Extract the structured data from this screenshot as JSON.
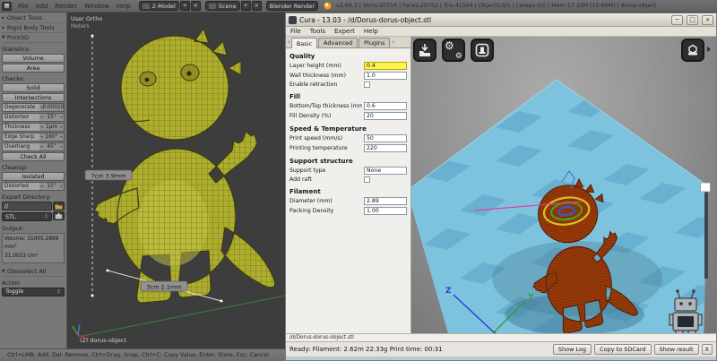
{
  "colors": {
    "bed_blue": "#7dc3de",
    "bed_checker": "#69b1d1",
    "model_red": "#a81e00",
    "wire_olive": "#aeae2e",
    "highlight_yellow": "#fbf24f",
    "axis_z_blue": "#2b43cc",
    "axis_y_green": "#2fa03a"
  },
  "icons": {
    "tri_right": "►",
    "tri_down": "▼",
    "arrow_left": "◂",
    "arrow_right": "▸",
    "updown": "↕",
    "plus": "+",
    "close": "×",
    "chev_left": "‹",
    "chev_right": "›",
    "gear": "⚙",
    "win_min": "─",
    "win_max": "□",
    "win_close": "×"
  },
  "blender": {
    "header": {
      "menus": [
        "File",
        "Add",
        "Render",
        "Window",
        "Help"
      ],
      "layout_name": "2-Model",
      "scene_name": "Scene",
      "engine": "Blender Render",
      "stats": "v2.66.3 | Verts:20754 | Faces:20752 | Tris:41504 | Objects:0/1 | Lamps:0/0 | Mem:17.33M (10.60M) | dorus-object"
    },
    "shelf": {
      "panel_object_tools": "Object Tools",
      "panel_rigid_body": "Rigid Body Tools",
      "panel_print3d": "Print3D",
      "statistics_label": "Statistics:",
      "volume_btn": "Volume",
      "area_btn": "Area",
      "checks_label": "Checks:",
      "solid_btn": "Solid",
      "intersections_btn": "Intersections",
      "checks": [
        {
          "label": "Degenerate",
          "value": "0.00010"
        },
        {
          "label": "Distorted",
          "value": "15°"
        },
        {
          "label": "Thickness",
          "value": "1μm"
        },
        {
          "label": "Edge Sharp",
          "value": "160°"
        },
        {
          "label": "Overhang",
          "value": "45°"
        }
      ],
      "check_all_btn": "Check All",
      "cleanup_label": "Cleanup:",
      "isolated_btn": "Isolated",
      "cleanup_distorted": {
        "label": "Distorted",
        "value": "15°"
      },
      "export_dir_label": "Export Directory:",
      "export_path": "//",
      "export_format": "STL",
      "output_label": "Output:",
      "output_line1": "Volume: 31005.2868 mm³",
      "output_line2": "31.0053 cm³",
      "deselect_panel": "(De)select All",
      "action_label": "Action",
      "action_value": "Toggle"
    },
    "viewport": {
      "view_label": "User Ortho",
      "units_label": "Meters",
      "measure_height": "7cm 3.9mm",
      "measure_width": "3cm 2.1mm",
      "object_label": "(2) dorus-object"
    },
    "status_bar": "Ctrl+LMB: Add, Del: Remove, Ctrl+Drag: Snap, Ctrl+C: Copy Value, Enter: Store, Esc: Cancel"
  },
  "cura": {
    "title": "Cura - 13.03 - /d/Dorus-dorus-object.stl",
    "menus": [
      "File",
      "Tools",
      "Expert",
      "Help"
    ],
    "tabs": [
      "Basic",
      "Advanced",
      "Plugins"
    ],
    "settings": {
      "quality_header": "Quality",
      "layer_height_label": "Layer height (mm)",
      "layer_height_value": "0.4",
      "wall_thickness_label": "Wall thickness (mm)",
      "wall_thickness_value": "1.0",
      "retraction_label": "Enable retraction",
      "fill_header": "Fill",
      "bottom_top_label": "Bottom/Top thickness (mm)",
      "bottom_top_value": "0.6",
      "fill_density_label": "Fill Density (%)",
      "fill_density_value": "20",
      "speed_header": "Speed & Temperature",
      "print_speed_label": "Print speed (mm/s)",
      "print_speed_value": "50",
      "print_temp_label": "Printing temperature",
      "print_temp_value": "220",
      "support_header": "Support structure",
      "support_type_label": "Support type",
      "support_type_value": "None",
      "add_raft_label": "Add raft",
      "filament_header": "Filament",
      "diameter_label": "Diameter (mm)",
      "diameter_value": "2.89",
      "packing_label": "Packing Density",
      "packing_value": "1.00"
    },
    "viewport": {
      "z_label": "Z",
      "y_label": "Y"
    },
    "file_label": "/d/Dorus-dorus-object.stl",
    "status_text": "Ready: Filament: 2.62m 22.33g Print time: 00:31",
    "show_log_btn": "Show Log",
    "copy_sd_btn": "Copy to SDCard",
    "show_result_btn": "Show result",
    "close_result_btn": "X"
  }
}
